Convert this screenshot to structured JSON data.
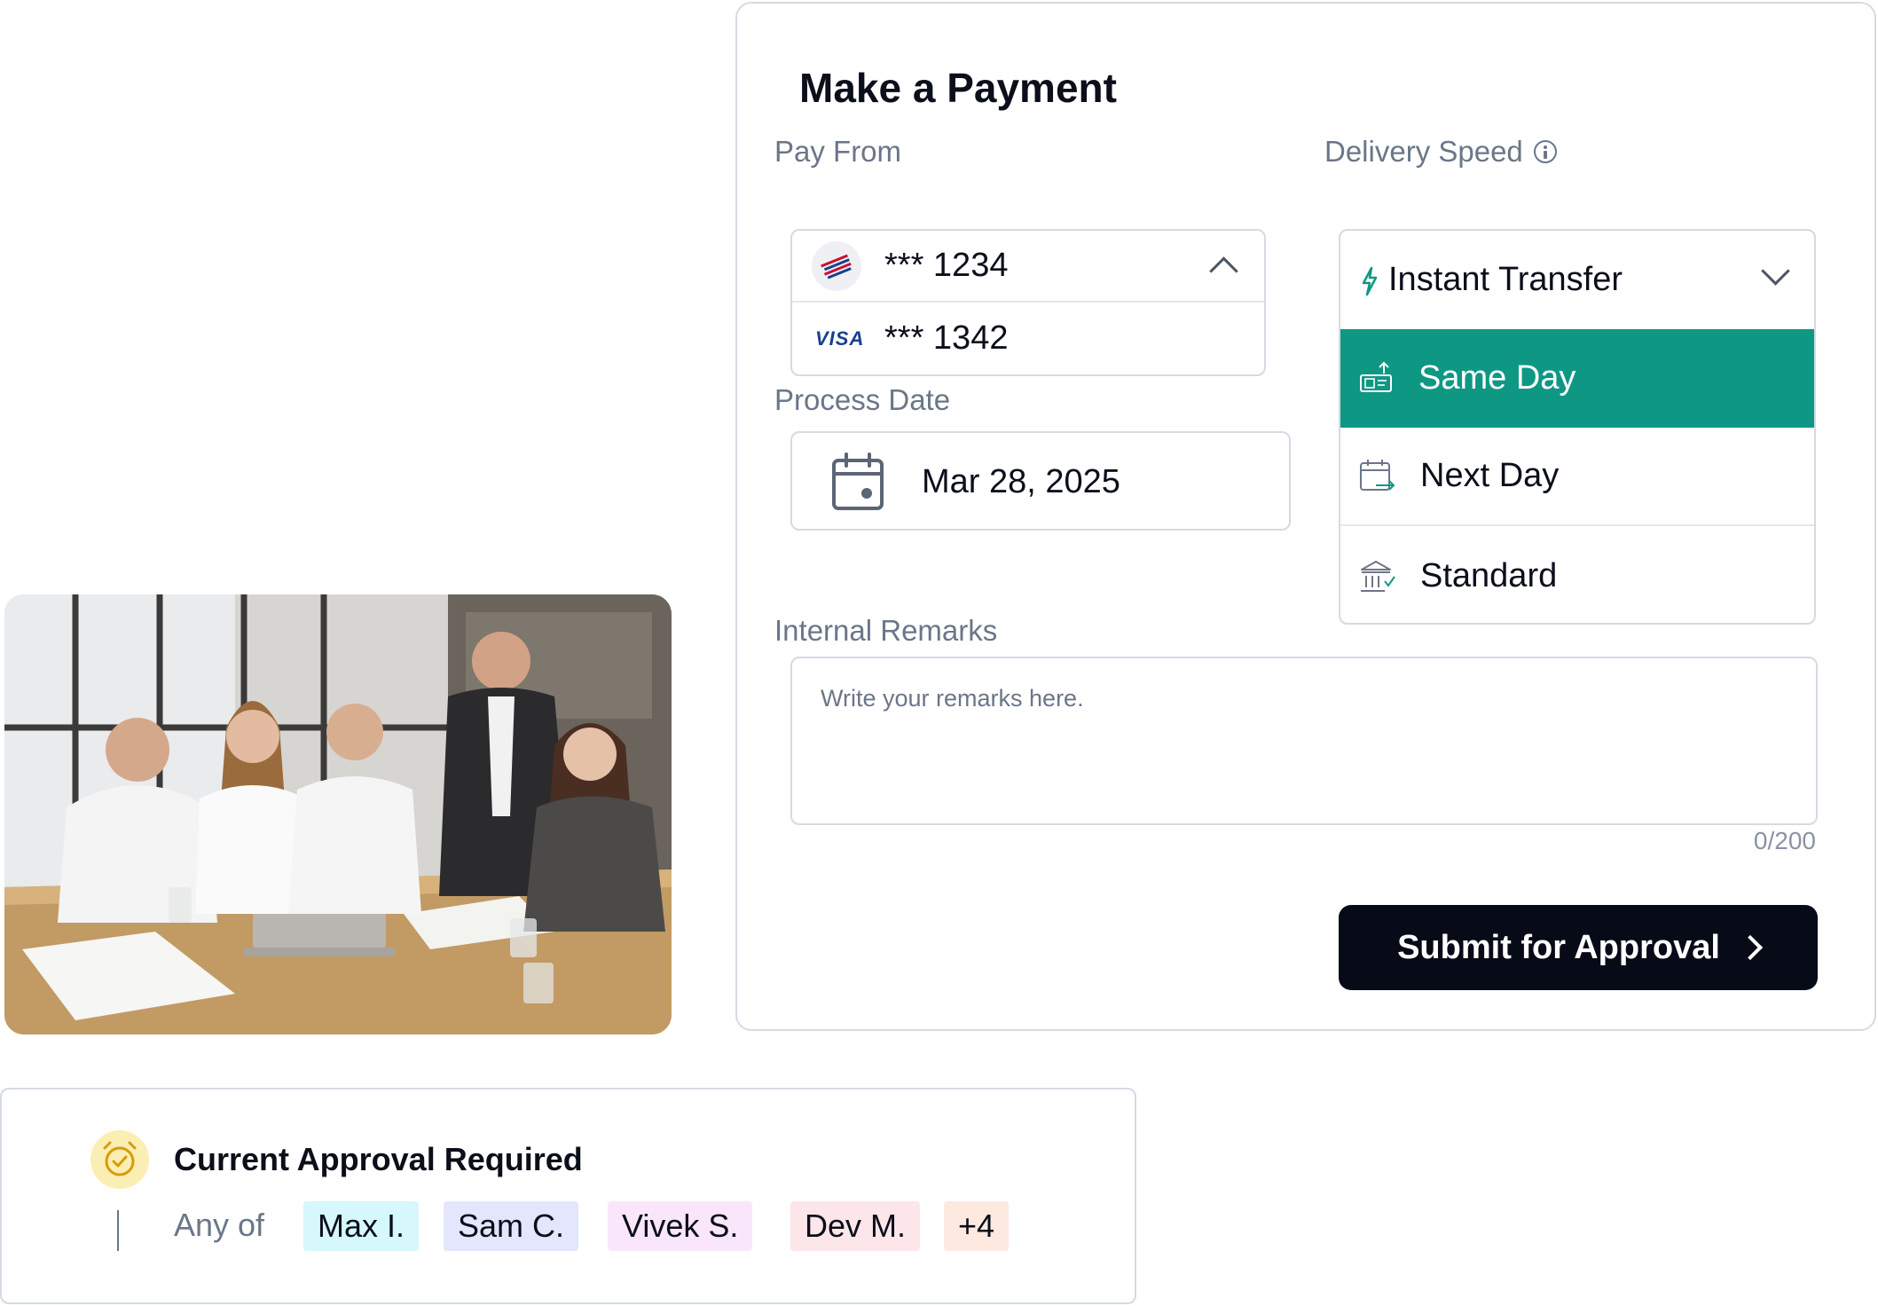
{
  "payment": {
    "title": "Make a Payment",
    "pay_from": {
      "label": "Pay From",
      "accounts": [
        {
          "icon": "bank-flag-icon",
          "number": "*** 1234"
        },
        {
          "icon": "visa-icon",
          "brand": "VISA",
          "number": "*** 1342"
        }
      ]
    },
    "process_date": {
      "label": "Process Date",
      "value": "Mar 28, 2025"
    },
    "delivery_speed": {
      "label": "Delivery Speed",
      "selected": "Instant Transfer",
      "options": [
        {
          "label": "Same Day",
          "icon": "money-transfer-icon",
          "highlighted": true
        },
        {
          "label": "Next Day",
          "icon": "calendar-arrow-icon"
        },
        {
          "label": "Standard",
          "icon": "bank-building-icon"
        }
      ]
    },
    "remarks": {
      "label": "Internal Remarks",
      "placeholder": "Write your remarks here.",
      "counter": "0/200"
    },
    "submit_label": "Submit for Approval"
  },
  "approval": {
    "title": "Current Approval Required",
    "prefix": "Any of",
    "approvers": [
      {
        "name": "Max I.",
        "color": "#d6f7fb"
      },
      {
        "name": "Sam C.",
        "color": "#e3e6fd"
      },
      {
        "name": "Vivek S.",
        "color": "#fae6fb"
      },
      {
        "name": "Dev M.",
        "color": "#fde6ea"
      },
      {
        "name": "+4",
        "color": "#fde9df"
      }
    ]
  },
  "colors": {
    "accent_teal": "#0e9884",
    "button_dark": "#070b18",
    "alarm_badge": "#fbeeb3"
  }
}
